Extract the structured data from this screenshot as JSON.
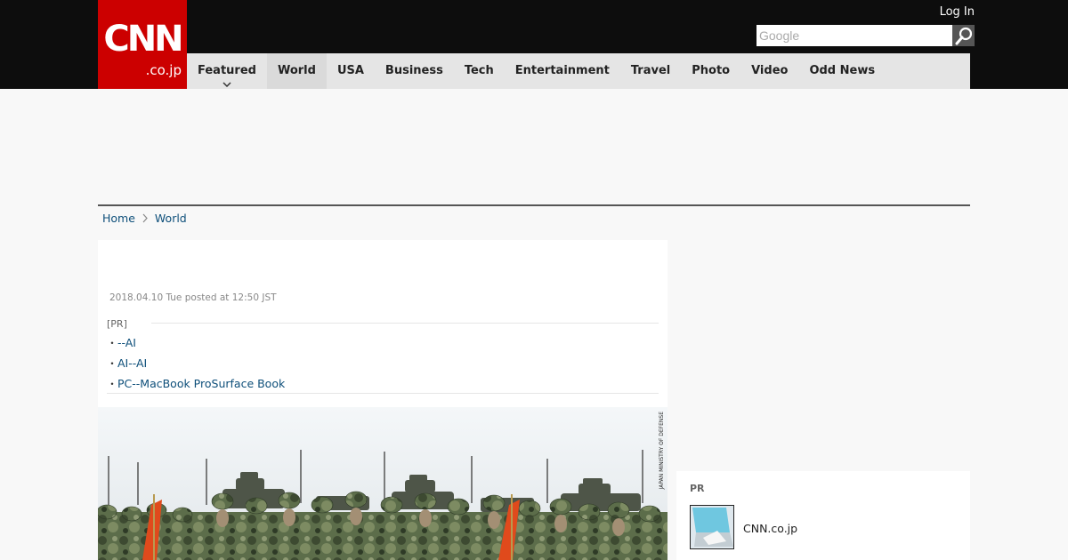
{
  "header": {
    "logo_main": "CNN",
    "logo_sub": ".co.jp",
    "login_label": "Log In",
    "search": {
      "placeholder": "Google"
    }
  },
  "nav": {
    "items": [
      {
        "label": "Featured"
      },
      {
        "label": "World"
      },
      {
        "label": "USA"
      },
      {
        "label": "Business"
      },
      {
        "label": "Tech"
      },
      {
        "label": "Entertainment"
      },
      {
        "label": "Travel"
      },
      {
        "label": "Photo"
      },
      {
        "label": "Video"
      },
      {
        "label": "Odd News"
      }
    ]
  },
  "breadcrumb": {
    "home": "Home",
    "current": "World"
  },
  "article": {
    "posted": "2018.04.10 Tue posted at 12:50 JST",
    "pr_label": "[PR]",
    "pr_links": [
      "--AI",
      "AI--AI",
      "PC--MacBook ProSurface Book"
    ],
    "bullet": "・",
    "photo_credit": "JAPAN MINISTRY OF DEFENSE"
  },
  "sidebar": {
    "pr_label": "PR",
    "item_title": "CNN.co.jp"
  },
  "colors": {
    "brand_red": "#cc0000",
    "topbar": "#0d0d0d",
    "link": "#0e4f7a"
  }
}
